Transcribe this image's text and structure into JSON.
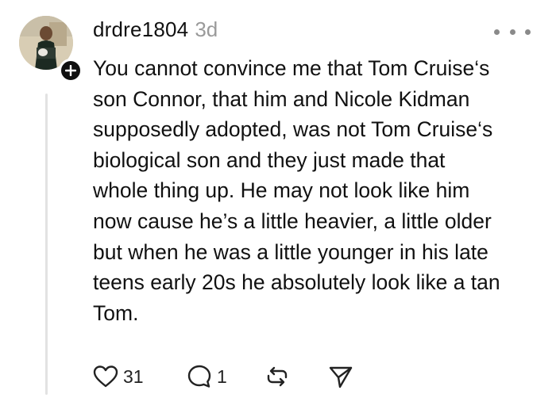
{
  "post": {
    "username": "drdre1804",
    "time": "3d",
    "text": "You cannot convince me that Tom Cruise‘s\nson Connor, that him and Nicole Kidman\nsupposedly adopted, was not Tom Cruise‘s\nbiological son and they just made that\nwhole thing up. He may not look like him\nnow cause he’s a little heavier, a little older\nbut when he was a little younger in his late\nteens early 20s he absolutely look like a tan\nTom.",
    "likes": "31",
    "replies": "1"
  },
  "icons": {
    "more": "more-dots-icon",
    "like": "heart-icon",
    "reply": "comment-icon",
    "repost": "repost-icon",
    "share": "send-icon",
    "follow": "plus-icon"
  }
}
